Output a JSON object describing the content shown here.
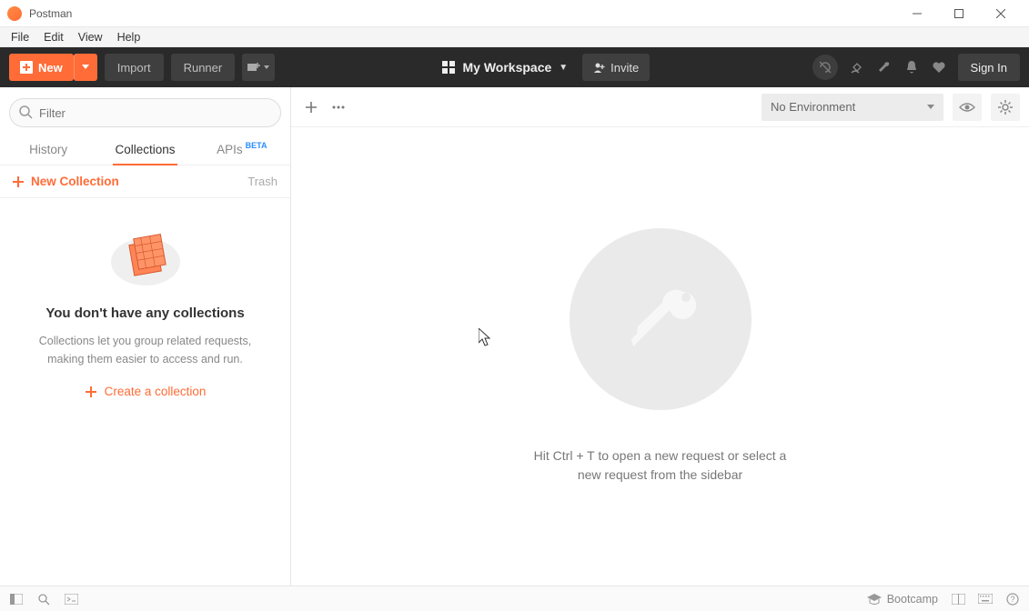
{
  "app": {
    "title": "Postman"
  },
  "menu": {
    "items": [
      "File",
      "Edit",
      "View",
      "Help"
    ]
  },
  "toolbar": {
    "new_label": "New",
    "import_label": "Import",
    "runner_label": "Runner",
    "workspace_label": "My Workspace",
    "invite_label": "Invite",
    "signin_label": "Sign In"
  },
  "sidebar": {
    "filter_placeholder": "Filter",
    "tabs": {
      "history": "History",
      "collections": "Collections",
      "apis": "APIs",
      "apis_badge": "BETA"
    },
    "new_collection_label": "New Collection",
    "trash_label": "Trash",
    "empty": {
      "heading": "You don't have any collections",
      "desc": "Collections let you group related requests, making them easier to access and run.",
      "create_label": "Create a collection"
    }
  },
  "main": {
    "env_label": "No Environment",
    "empty_text_l1": "Hit Ctrl + T to open a new request or select a",
    "empty_text_l2": "new request from the sidebar"
  },
  "statusbar": {
    "bootcamp_label": "Bootcamp"
  },
  "colors": {
    "accent": "#ff6c37"
  }
}
